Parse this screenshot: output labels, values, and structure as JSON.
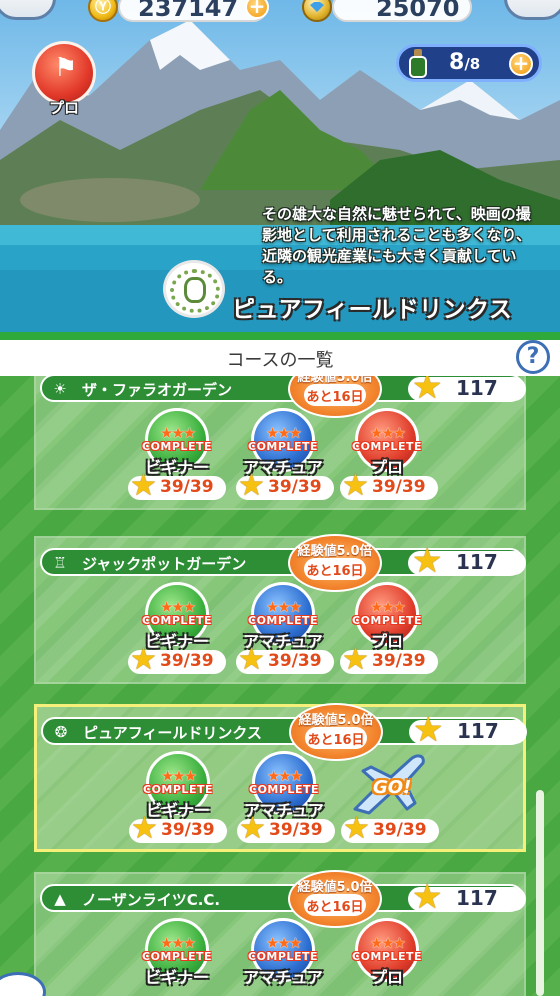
{
  "currency": {
    "coins": "237147",
    "points": "25070"
  },
  "rank_badge": {
    "label": "プロ"
  },
  "stamina": {
    "current": "8",
    "max": "/8"
  },
  "hero": {
    "description": "その雄大な自然に魅せられて、映画の撮影地として利用されることも多くなり、近隣の観光産業にも大きく貢献している。",
    "course_name": "ピュアフィールドリンクス"
  },
  "list_header": {
    "title": "コースの一覧",
    "help": "?"
  },
  "bonus": {
    "exp_label": "経験値5.0倍",
    "days_left": "あと16日"
  },
  "medal_texts": {
    "complete": "COMPLETE",
    "beginner": "ビギナー",
    "amateur": "アマチュア",
    "pro": "プロ",
    "go": "GO!"
  },
  "courses": [
    {
      "name": "ザ・ファラオガーデン",
      "stars": "117",
      "beginner_score": "39/39",
      "amateur_score": "39/39",
      "pro_score": "39/39"
    },
    {
      "name": "ジャックポットガーデン",
      "stars": "117",
      "beginner_score": "39/39",
      "amateur_score": "39/39",
      "pro_score": "39/39"
    },
    {
      "name": "ピュアフィールドリンクス",
      "stars": "117",
      "beginner_score": "39/39",
      "amateur_score": "39/39",
      "pro_score": "39/39"
    },
    {
      "name": "ノーザンライツC.C.",
      "stars": "117",
      "beginner_score": "",
      "amateur_score": "",
      "pro_score": ""
    }
  ],
  "colors": {
    "header_green": "#2faa3a",
    "list_bg": "#4aa843",
    "selected_border": "#f4f07a",
    "bonus_orange": "#f3862e"
  }
}
